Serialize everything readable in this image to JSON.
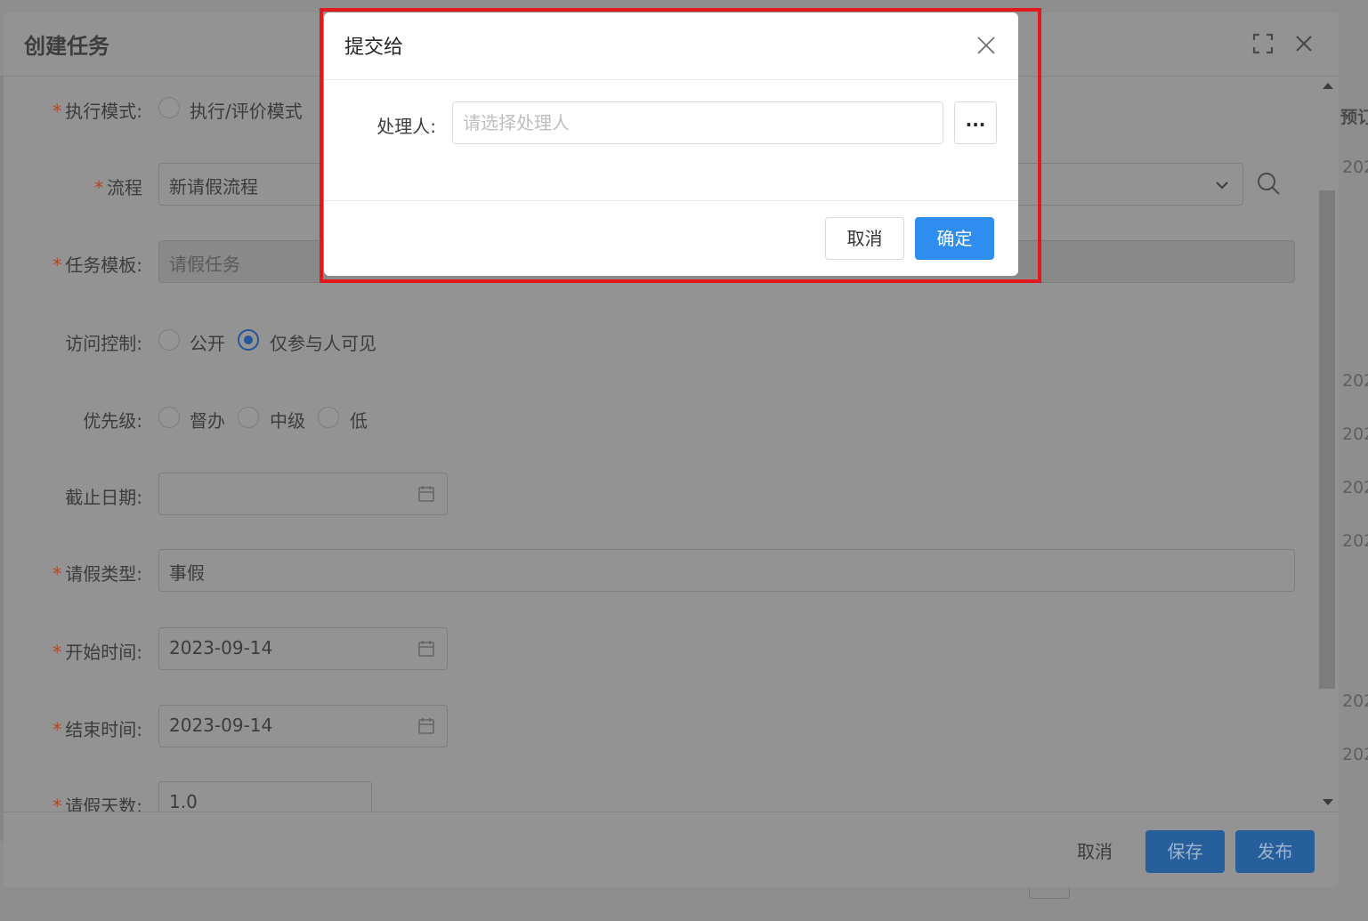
{
  "background": {
    "right_column_header": "预订",
    "right_column_cells": [
      "202",
      "202",
      "202",
      "202",
      "202",
      "202",
      "202"
    ]
  },
  "main_dialog": {
    "title": "创建任务",
    "form": {
      "exec_mode": {
        "label": "执行模式:",
        "required": "*",
        "option1": "执行/评价模式"
      },
      "process": {
        "label": "流程",
        "required": "*",
        "value": "新请假流程"
      },
      "template": {
        "label": "任务模板:",
        "required": "*",
        "value": "请假任务"
      },
      "access": {
        "label": "访问控制:",
        "option_public": "公开",
        "option_participants": "仅参与人可见",
        "selected": "仅参与人可见"
      },
      "priority": {
        "label": "优先级:",
        "option_urgent": "督办",
        "option_mid": "中级",
        "option_low": "低"
      },
      "deadline": {
        "label": "截止日期:",
        "value": ""
      },
      "leave_type": {
        "label": "请假类型:",
        "required": "*",
        "value": "事假"
      },
      "start_time": {
        "label": "开始时间:",
        "required": "*",
        "value": "2023-09-14"
      },
      "end_time": {
        "label": "结束时间:",
        "required": "*",
        "value": "2023-09-14"
      },
      "leave_days": {
        "label": "请假天数:",
        "required": "*",
        "value": "1.0"
      }
    },
    "footer": {
      "cancel": "取消",
      "save": "保存",
      "publish": "发布"
    }
  },
  "submit_modal": {
    "title": "提交给",
    "handler_label": "处理人:",
    "handler_value": "",
    "handler_placeholder": "请选择处理人",
    "more_label": "...",
    "cancel": "取消",
    "confirm": "确定"
  },
  "colors": {
    "highlight": "#e2191c",
    "primary": "#2f8df0",
    "required": "#b4451f"
  }
}
